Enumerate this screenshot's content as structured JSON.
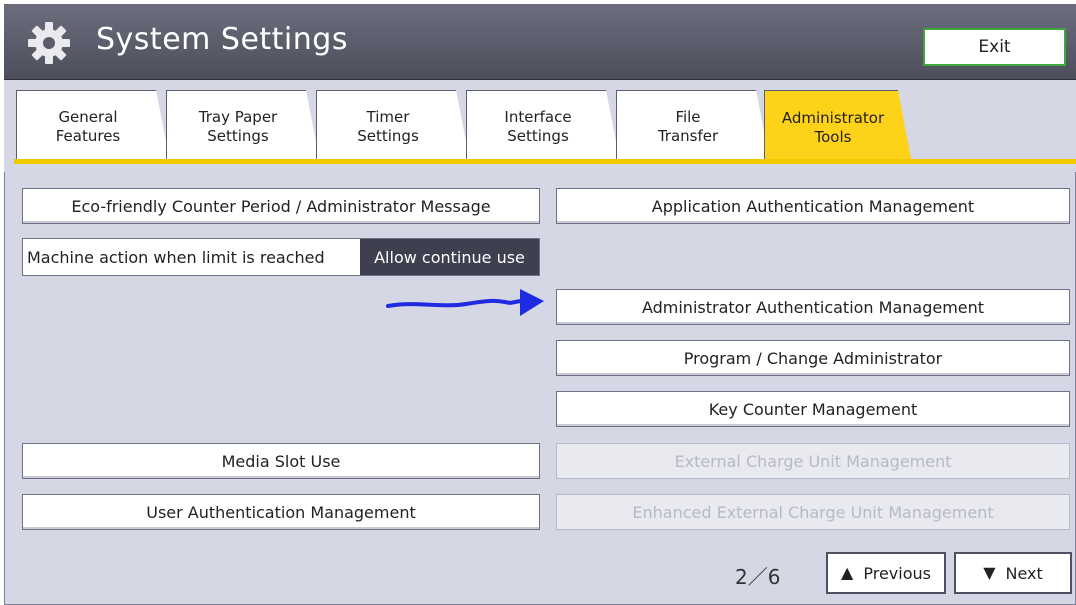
{
  "window": {
    "title": "System Settings",
    "exit_label": "Exit"
  },
  "tabs": [
    {
      "label": "General\nFeatures",
      "active": false
    },
    {
      "label": "Tray Paper\nSettings",
      "active": false
    },
    {
      "label": "Timer\nSettings",
      "active": false
    },
    {
      "label": "Interface\nSettings",
      "active": false
    },
    {
      "label": "File\nTransfer",
      "active": false
    },
    {
      "label": "Administrator\nTools",
      "active": true
    }
  ],
  "left_buttons": {
    "eco": "Eco-friendly Counter Period / Administrator Message",
    "machine_action_label": "Machine action when limit is reached",
    "machine_action_value": "Allow continue use",
    "media_slot": "Media Slot Use",
    "user_auth": "User Authentication Management"
  },
  "right_buttons": {
    "app_auth": "Application Authentication Management",
    "admin_auth": "Administrator Authentication Management",
    "program_admin": "Program / Change Administrator",
    "key_counter": "Key Counter Management",
    "ext_charge": "External Charge Unit Management",
    "enh_ext_charge": "Enhanced External Charge Unit Management"
  },
  "pager": {
    "indicator": "2／6",
    "previous": "Previous",
    "next": "Next"
  },
  "colors": {
    "active_tab": "#ffd21a",
    "title_bar": "#55576a",
    "annotation": "#1f2be0",
    "exit_border": "#3fa53f"
  },
  "icons": {
    "title": "gear-icon",
    "previous": "triangle-up-icon",
    "next": "triangle-down-icon"
  }
}
